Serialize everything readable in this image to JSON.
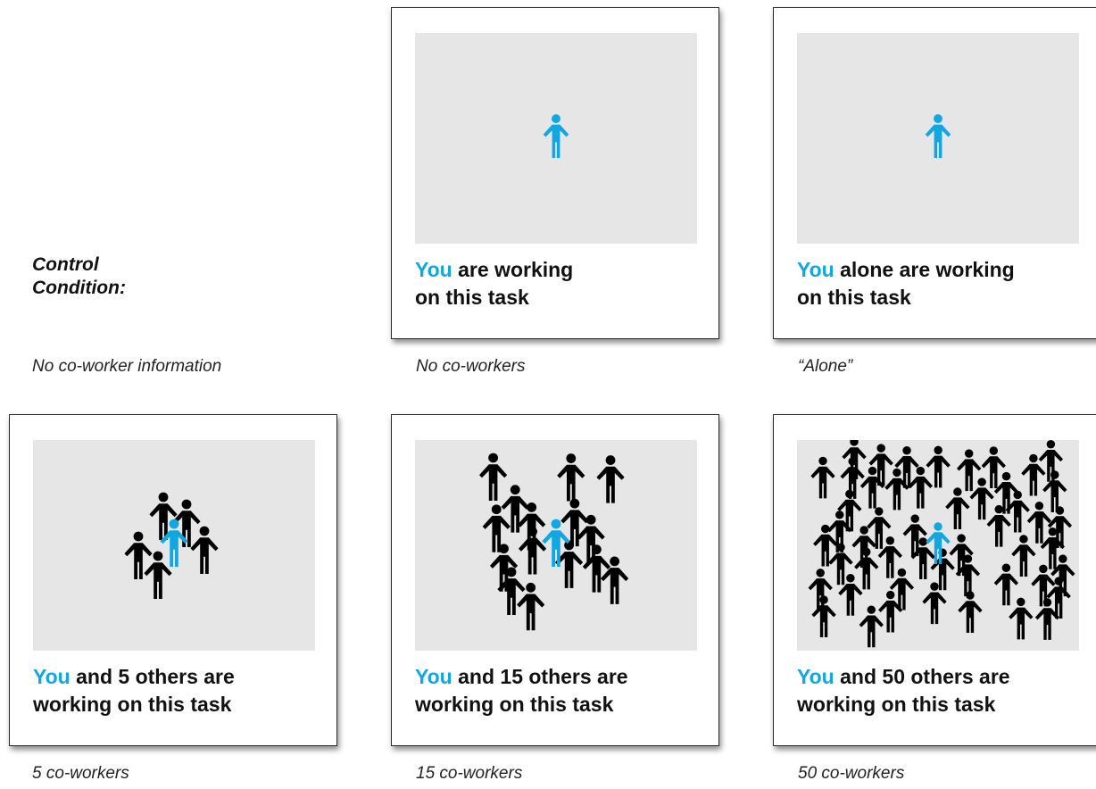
{
  "control": {
    "title_line1": "Control",
    "title_line2": "Condition:",
    "caption": "No co-worker information"
  },
  "colors": {
    "you": "#12a7e0",
    "others": "#000000",
    "panel": "#e6e6e6"
  },
  "icons": {
    "person": "person-icon"
  },
  "cards": [
    {
      "you": "You",
      "line1_rest": " are working",
      "line2": "on this task",
      "caption": "No co-workers",
      "others_count": 0
    },
    {
      "you": "You",
      "line1_rest": " alone are working",
      "line2": "on this task",
      "caption": "“Alone”",
      "others_count": 0
    },
    {
      "you": "You",
      "line1_rest": " and 5 others are",
      "line2": "working on this task",
      "caption": "5 co-workers",
      "others_count": 5
    },
    {
      "you": "You",
      "line1_rest": " and 15 others are",
      "line2": "working on this task",
      "caption": "15 co-workers",
      "others_count": 15
    },
    {
      "you": "You",
      "line1_rest": " and 50 others are",
      "line2": "working on this task",
      "caption": "50 co-workers",
      "others_count": 50
    }
  ]
}
